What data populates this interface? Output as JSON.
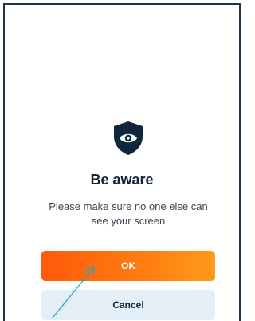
{
  "dialog": {
    "title": "Be aware",
    "message": "Please make sure no one else can see your screen",
    "icon": "shield-eye-icon"
  },
  "buttons": {
    "ok_label": "OK",
    "cancel_label": "Cancel"
  },
  "colors": {
    "frame": "#1a3350",
    "shield": "#10263d",
    "ok_gradient_start": "#ff5a0a",
    "ok_gradient_end": "#ff9a1a",
    "cancel_bg": "#e4eef7",
    "pointer_line": "#1aa6c8"
  }
}
